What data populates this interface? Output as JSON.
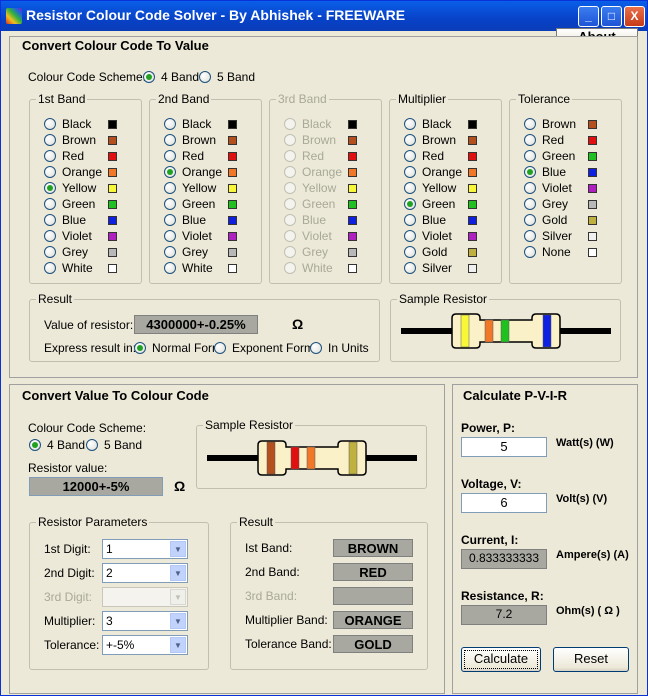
{
  "window": {
    "title": "Resistor Colour Code Solver - By Abhishek - FREEWARE",
    "minimize": "_",
    "maximize": "□",
    "close": "X"
  },
  "about": "About",
  "c2v": {
    "title": "Convert Colour Code To Value",
    "scheme_label": "Colour Code Scheme:",
    "scheme_opts": [
      "4 Band",
      "5 Band"
    ],
    "bands": [
      {
        "title": "1st Band",
        "items": [
          "Black",
          "Brown",
          "Red",
          "Orange",
          "Yellow",
          "Green",
          "Blue",
          "Violet",
          "Grey",
          "White"
        ],
        "selected": 4
      },
      {
        "title": "2nd Band",
        "items": [
          "Black",
          "Brown",
          "Red",
          "Orange",
          "Yellow",
          "Green",
          "Blue",
          "Violet",
          "Grey",
          "White"
        ],
        "selected": 3
      },
      {
        "title": "3rd Band",
        "items": [
          "Black",
          "Brown",
          "Red",
          "Orange",
          "Yellow",
          "Green",
          "Blue",
          "Violet",
          "Grey",
          "White"
        ],
        "selected": -1
      },
      {
        "title": "Multiplier",
        "items": [
          "Black",
          "Brown",
          "Red",
          "Orange",
          "Yellow",
          "Green",
          "Blue",
          "Violet",
          "Gold",
          "Silver"
        ],
        "selected": 5
      },
      {
        "title": "Tolerance",
        "items": [
          "Brown",
          "Red",
          "Green",
          "Blue",
          "Violet",
          "Grey",
          "Gold",
          "Silver",
          "None"
        ],
        "selected": 3
      }
    ],
    "result_title": "Result",
    "value_label": "Value of resistor:",
    "value": "4300000+-0.25%",
    "ohm": "Ω",
    "express_label": "Express result in:",
    "express_opts": [
      "Normal Form",
      "Exponent Form",
      "In Units"
    ],
    "sample_title": "Sample Resistor"
  },
  "v2c": {
    "title": "Convert Value To Colour Code",
    "scheme_label": "Colour Code Scheme:",
    "scheme_opts": [
      "4 Band",
      "5 Band"
    ],
    "sample_title": "Sample Resistor",
    "value_label": "Resistor value:",
    "value": "12000+-5%",
    "ohm": "Ω",
    "params_title": "Resistor Parameters",
    "params": [
      {
        "label": "1st Digit:",
        "value": "1"
      },
      {
        "label": "2nd Digit:",
        "value": "2"
      },
      {
        "label": "3rd Digit:",
        "value": ""
      },
      {
        "label": "Multiplier:",
        "value": "3"
      },
      {
        "label": "Tolerance:",
        "value": "+-5%"
      }
    ],
    "result_title": "Result",
    "results": [
      {
        "label": "Ist Band:",
        "value": "BROWN"
      },
      {
        "label": "2nd Band:",
        "value": "RED"
      },
      {
        "label": "3rd Band:",
        "value": ""
      },
      {
        "label": "Multiplier Band:",
        "value": "ORANGE"
      },
      {
        "label": "Tolerance Band:",
        "value": "GOLD"
      }
    ]
  },
  "pvir": {
    "title": "Calculate P-V-I-R",
    "power_label": "Power, P:",
    "power": "5",
    "power_unit": "Watt(s) (W)",
    "voltage_label": "Voltage, V:",
    "voltage": "6",
    "voltage_unit": "Volt(s) (V)",
    "current_label": "Current, I:",
    "current": "0.833333333",
    "current_unit": "Ampere(s) (A)",
    "resistance_label": "Resistance, R:",
    "resistance": "7.2",
    "resistance_unit": "Ohm(s) ( Ω )",
    "calculate": "Calculate",
    "reset": "Reset"
  },
  "colors": {
    "Black": "#000000",
    "Brown": "#b4501e",
    "Red": "#e01010",
    "Orange": "#f07828",
    "Yellow": "#f8f838",
    "Green": "#20c020",
    "Blue": "#1020e0",
    "Violet": "#b020c0",
    "Grey": "#b8b8b8",
    "White": "#ffffff",
    "Gold": "#c0b040",
    "Silver": "#f0f0f0",
    "None": "#ffffff"
  },
  "sample1_bands": [
    "#f8f838",
    "#f07828",
    "#20c020",
    "#1020e0"
  ],
  "sample2_bands": [
    "#b4501e",
    "#e01010",
    "#f07828",
    "#c0b040"
  ]
}
